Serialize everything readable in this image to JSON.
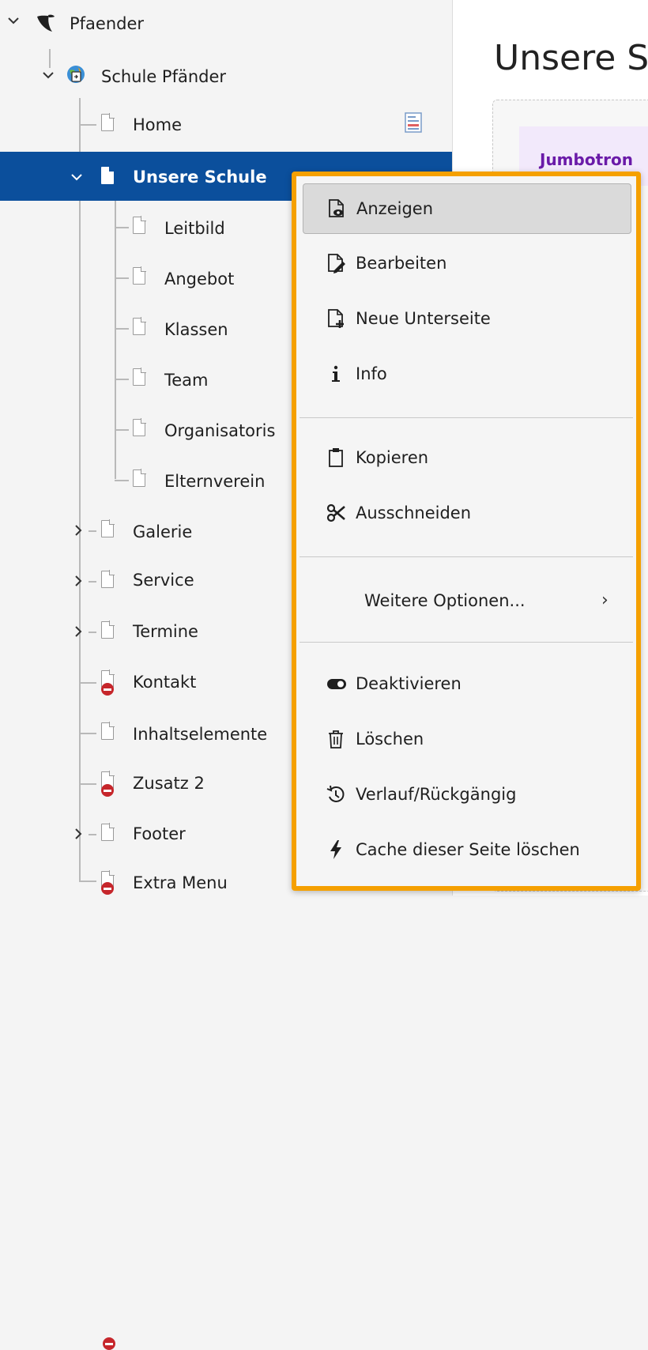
{
  "tree": {
    "root": "Pfaender",
    "site": "Schule Pfänder",
    "items": [
      {
        "label": "Home"
      },
      {
        "label": "Unsere Schule"
      },
      {
        "label": "Leitbild"
      },
      {
        "label": "Angebot"
      },
      {
        "label": "Klassen"
      },
      {
        "label": "Team"
      },
      {
        "label": "Organisatoris"
      },
      {
        "label": "Elternverein"
      },
      {
        "label": "Galerie"
      },
      {
        "label": "Service"
      },
      {
        "label": "Termine"
      },
      {
        "label": "Kontakt"
      },
      {
        "label": "Inhaltselemente"
      },
      {
        "label": "Zusatz 2"
      },
      {
        "label": "Footer"
      },
      {
        "label": "Extra Menu"
      }
    ],
    "icons": {
      "chevron_down": "⌄",
      "chevron_right": "›"
    }
  },
  "content": {
    "heading": "Unsere S",
    "jumbotron": "Jumbotron"
  },
  "context_menu": {
    "items": [
      {
        "label": "Anzeigen",
        "icon": "eye-page-icon"
      },
      {
        "label": "Bearbeiten",
        "icon": "edit-page-icon"
      },
      {
        "label": "Neue Unterseite",
        "icon": "new-page-icon"
      },
      {
        "label": "Info",
        "icon": "info-icon"
      },
      {
        "label": "Kopieren",
        "icon": "clipboard-icon"
      },
      {
        "label": "Ausschneiden",
        "icon": "scissors-icon"
      },
      {
        "label": "Weitere Optionen...",
        "icon": "chevron-right-icon"
      },
      {
        "label": "Deaktivieren",
        "icon": "toggle-icon"
      },
      {
        "label": "Löschen",
        "icon": "trash-icon"
      },
      {
        "label": "Verlauf/Rückgängig",
        "icon": "history-icon"
      },
      {
        "label": "Cache dieser Seite löschen",
        "icon": "bolt-icon"
      }
    ],
    "submenu_chevron": "›"
  },
  "colors": {
    "selection": "#0b4f9c",
    "menu_highlight_border": "#f5a000",
    "restricted_badge": "#c6262b",
    "jumbotron_text": "#6a1aa8"
  }
}
